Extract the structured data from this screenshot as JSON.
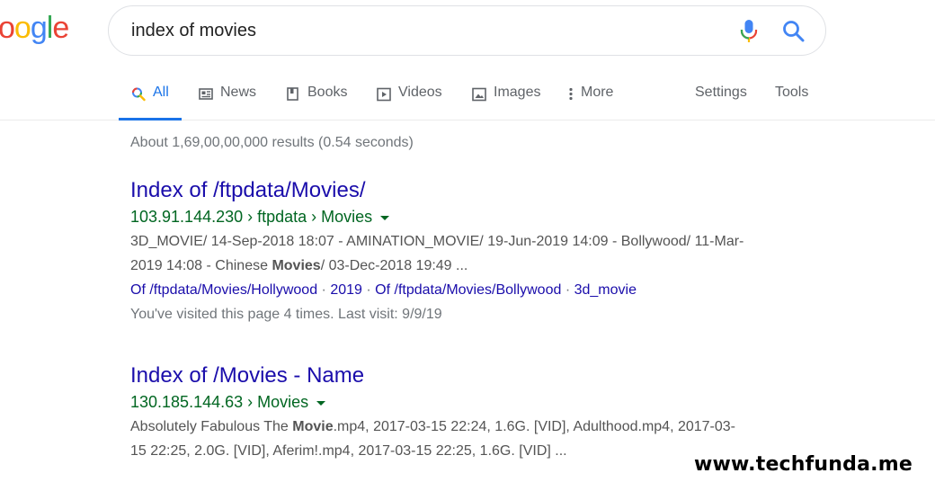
{
  "logo": {
    "text": "oogle",
    "letters": [
      "o",
      "o",
      "g",
      "l",
      "e"
    ]
  },
  "colors": {
    "blue": "#4285f4",
    "red": "#ea4335",
    "yellow": "#fbbc05",
    "green": "#34a853",
    "link": "#1a0dab",
    "url_green": "#006621",
    "active_tab": "#1a73e8"
  },
  "search": {
    "value": "index of movies",
    "mic_icon": "mic-icon",
    "search_icon": "search-icon"
  },
  "tabs": [
    {
      "label": "All",
      "icon": "search-icon",
      "active": true
    },
    {
      "label": "News",
      "icon": "news-icon"
    },
    {
      "label": "Books",
      "icon": "book-icon"
    },
    {
      "label": "Videos",
      "icon": "play-icon"
    },
    {
      "label": "Images",
      "icon": "image-icon"
    },
    {
      "label": "More",
      "icon": "more-vert-icon"
    },
    {
      "label": "Settings"
    },
    {
      "label": "Tools"
    }
  ],
  "stats": "About 1,69,00,00,000 results (0.54 seconds)",
  "results": [
    {
      "title": "Index of /ftpdata/Movies/",
      "url": "103.91.144.230 › ftpdata › Movies",
      "snippet_line1": "3D_MOVIE/ 14-Sep-2018 18:07 - AMINATION_MOVIE/ 19-Jun-2019 14:09 - Bollywood/ 11-Mar-",
      "snippet_line2_pre": "2019 14:08 - Chinese ",
      "snippet_line2_bold": "Movies",
      "snippet_line2_post": "/ 03-Dec-2018 19:49 ...",
      "sitelinks": [
        "Of /ftpdata/Movies/Hollywood",
        "2019",
        "Of /ftpdata/Movies/Bollywood",
        "3d_movie"
      ],
      "sitelink_separator": "·",
      "visited": "You've visited this page 4 times. Last visit: 9/9/19"
    },
    {
      "title": "Index of /Movies - Name",
      "url": "130.185.144.63 › Movies",
      "snippet_line1_pre": "Absolutely Fabulous The ",
      "snippet_line1_bold": "Movie",
      "snippet_line1_post": ".mp4, 2017-03-15 22:24, 1.6G. [VID], Adulthood.mp4, 2017-03-",
      "snippet_line2": "15 22:25, 2.0G. [VID], Aferim!.mp4, 2017-03-15 22:25, 1.6G. [VID] ..."
    }
  ],
  "watermark": "www.techfunda.me"
}
